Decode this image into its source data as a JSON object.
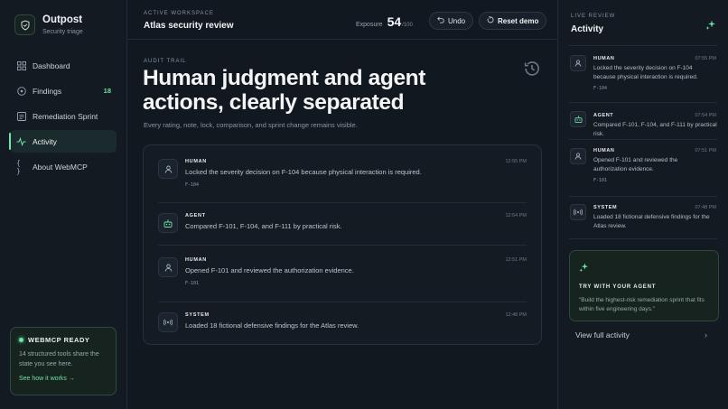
{
  "brand": {
    "name": "Outpost",
    "subtitle": "Security triage",
    "logo_icon": "shield-check-icon"
  },
  "sidebar": {
    "items": [
      {
        "label": "Dashboard",
        "icon": "grid-icon",
        "active": false,
        "badge": ""
      },
      {
        "label": "Findings",
        "icon": "target-icon",
        "active": false,
        "badge": "18"
      },
      {
        "label": "Remediation Sprint",
        "icon": "board-icon",
        "active": false,
        "badge": ""
      },
      {
        "label": "Activity",
        "icon": "pulse-icon",
        "active": true,
        "badge": ""
      },
      {
        "label": "About WebMCP",
        "icon": "braces-icon",
        "active": false,
        "badge": ""
      }
    ],
    "webmcp": {
      "title": "WEBMCP READY",
      "body": "14 structured tools share the state you see here.",
      "link": "See how it works →"
    }
  },
  "topbar": {
    "workspace_label": "ACTIVE WORKSPACE",
    "workspace_title": "Atlas security review",
    "exposure_label": "Exposure",
    "exposure_value": "54",
    "exposure_max": "/100",
    "undo_label": "Undo",
    "reset_label": "Reset demo"
  },
  "main": {
    "eyebrow": "AUDIT TRAIL",
    "headline": "Human judgment and agent actions, clearly separated",
    "subline": "Every rating, note, lock, comparison, and sprint change remains visible.",
    "entries": [
      {
        "role": "HUMAN",
        "text": "Locked the severity decision on F-104 because physical interaction is required.",
        "tag": "F-104",
        "time": "12:55 PM",
        "icon": "user-icon"
      },
      {
        "role": "AGENT",
        "text": "Compared F-101, F-104, and F-111 by practical risk.",
        "tag": "",
        "time": "12:54 PM",
        "icon": "robot-icon"
      },
      {
        "role": "HUMAN",
        "text": "Opened F-101 and reviewed the authorization evidence.",
        "tag": "F-101",
        "time": "12:51 PM",
        "icon": "user-icon"
      },
      {
        "role": "SYSTEM",
        "text": "Loaded 18 fictional defensive findings for the Atlas review.",
        "tag": "",
        "time": "12:48 PM",
        "icon": "broadcast-icon"
      }
    ]
  },
  "activity": {
    "eyebrow": "LIVE REVIEW",
    "title": "Activity",
    "entries": [
      {
        "role": "HUMAN",
        "text": "Locked the severity decision on F-104 because physical interaction is required.",
        "tag": "F-104",
        "time": "07:55 PM",
        "icon": "user-icon"
      },
      {
        "role": "AGENT",
        "text": "Compared F-101, F-104, and F-111 by practical risk.",
        "tag": "",
        "time": "07:54 PM",
        "icon": "robot-icon"
      },
      {
        "role": "HUMAN",
        "text": "Opened F-101 and reviewed the authorization evidence.",
        "tag": "F-101",
        "time": "07:51 PM",
        "icon": "user-icon"
      },
      {
        "role": "SYSTEM",
        "text": "Loaded 18 fictional defensive findings for the Atlas review.",
        "tag": "",
        "time": "07:48 PM",
        "icon": "broadcast-icon"
      }
    ],
    "try": {
      "title": "TRY WITH YOUR AGENT",
      "text": "\"Build the highest-risk remediation sprint that fits within five engineering days.\""
    },
    "view_full": "View full activity"
  },
  "colors": {
    "accent": "#6fe3a8",
    "background": "#121820",
    "panel": "#131a21"
  }
}
